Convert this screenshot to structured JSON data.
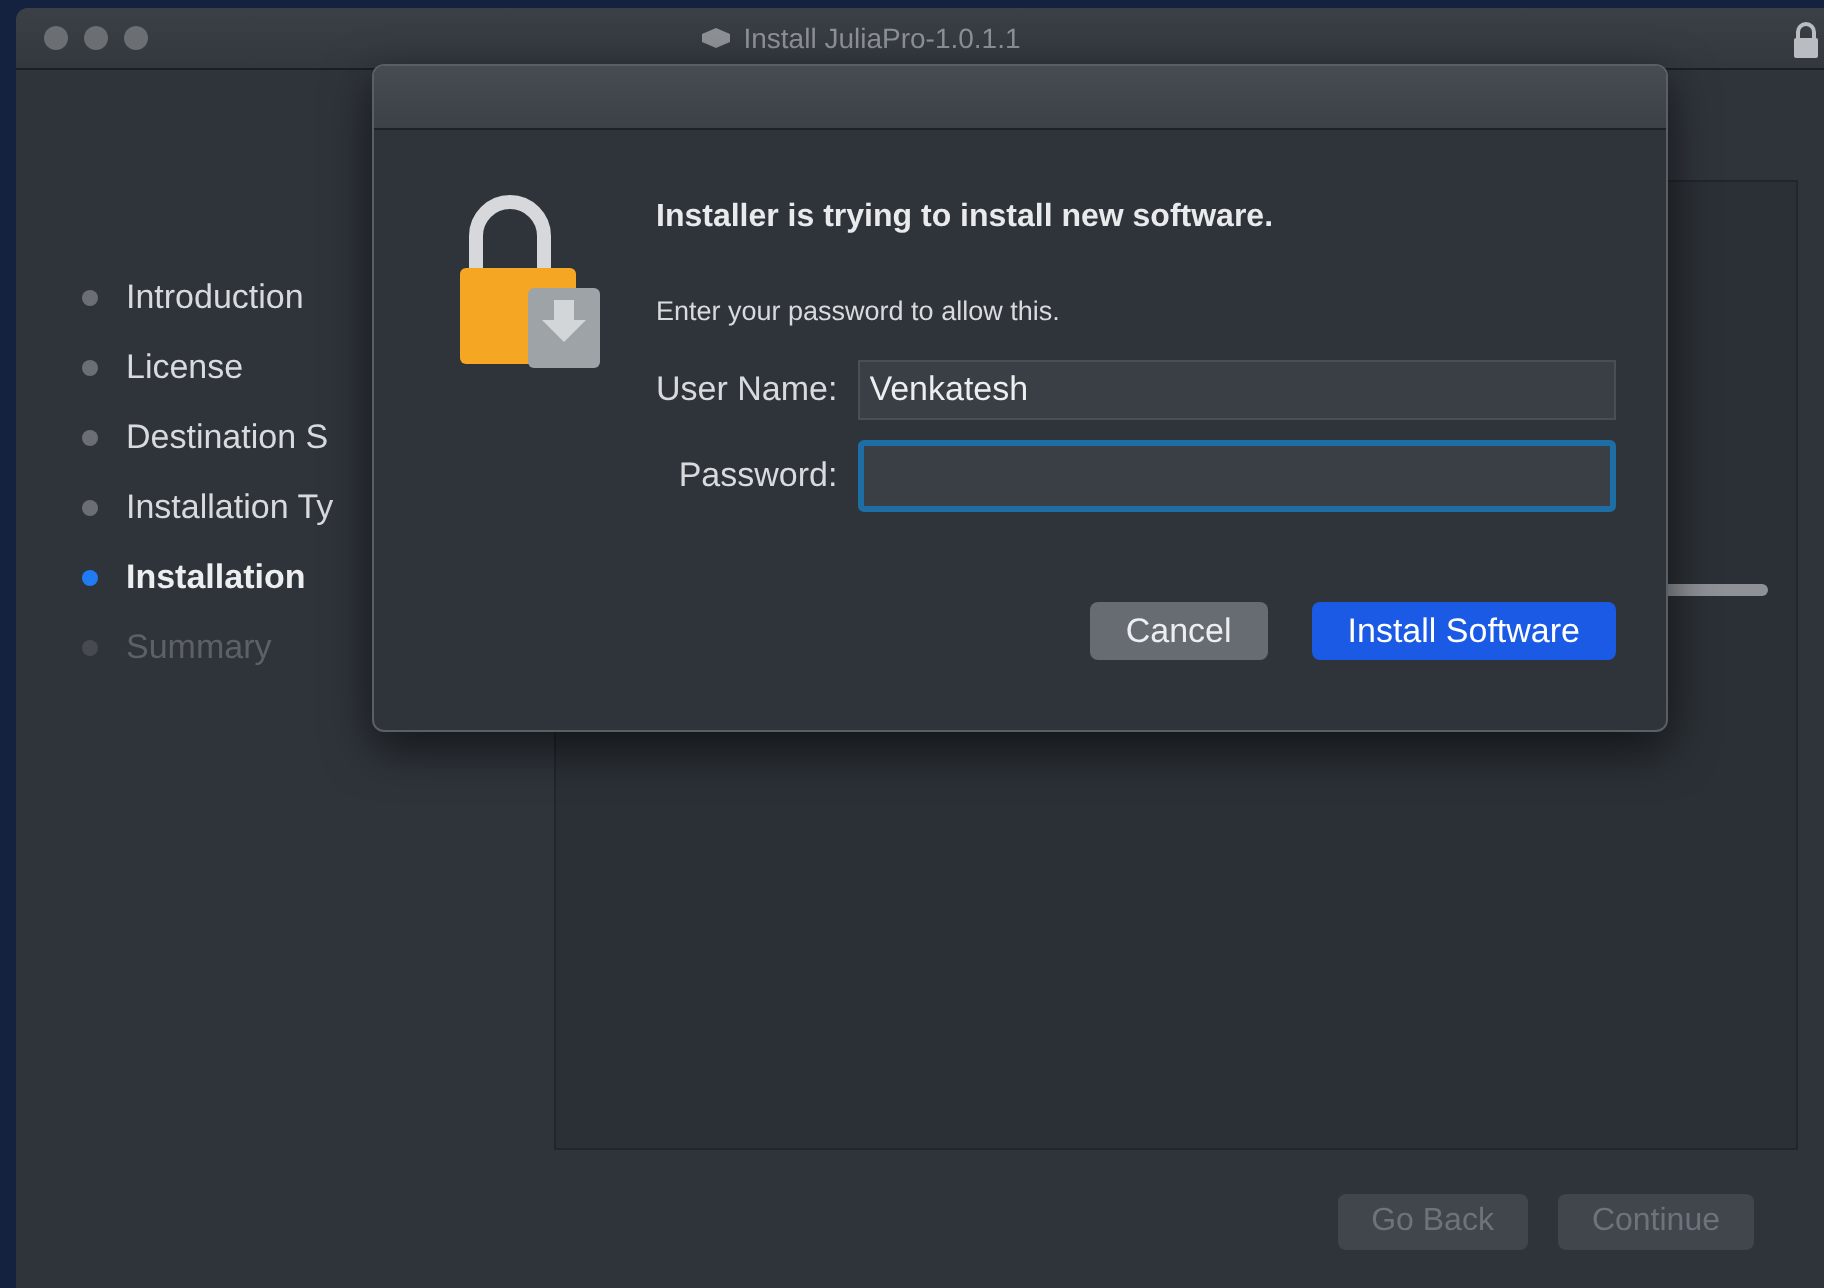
{
  "window": {
    "title": "Install JuliaPro-1.0.1.1"
  },
  "sidebar": {
    "items": [
      {
        "label": "Introduction",
        "selected": false,
        "disabled": false
      },
      {
        "label": "License",
        "selected": false,
        "disabled": false
      },
      {
        "label": "Destination S",
        "selected": false,
        "disabled": false
      },
      {
        "label": "Installation Ty",
        "selected": false,
        "disabled": false
      },
      {
        "label": "Installation",
        "selected": true,
        "disabled": false
      },
      {
        "label": "Summary",
        "selected": false,
        "disabled": true
      }
    ]
  },
  "progress": {
    "level": 0
  },
  "footer": {
    "buttons": [
      {
        "label": "Go Back",
        "disabled": true
      },
      {
        "label": "Continue",
        "disabled": true
      }
    ]
  },
  "dialog": {
    "heading": "Installer is trying to install new software.",
    "message": "Enter your password to allow this.",
    "fields": [
      {
        "label": "User Name:",
        "value": "Venkatesh",
        "focused": false
      },
      {
        "label": "Password:",
        "focused": true
      }
    ],
    "buttons": [
      {
        "label": "Cancel",
        "default": false
      },
      {
        "label": "Install Software",
        "default": true
      }
    ]
  }
}
